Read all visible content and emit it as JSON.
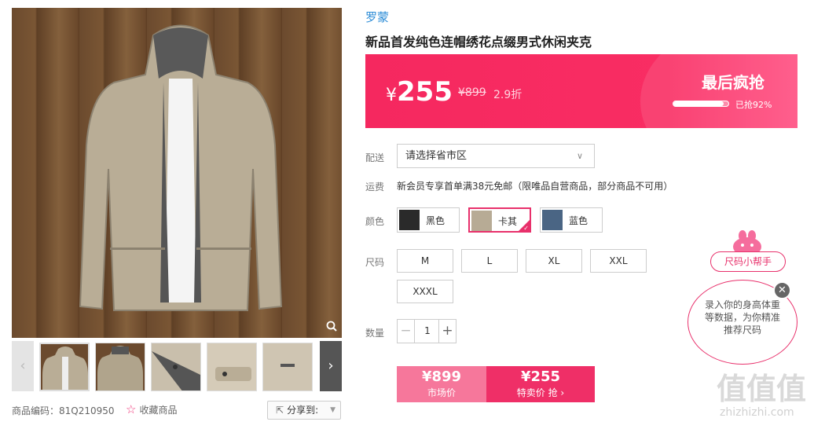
{
  "product": {
    "brand": "罗蒙",
    "title": "新品首发纯色连帽绣花点缀男式休闲夹克",
    "sku_label": "商品编码：81Q210950",
    "favorite_label": "收藏商品",
    "share_label": "分享到:"
  },
  "price": {
    "currency": "¥",
    "current": "255",
    "original": "¥899",
    "discount": "2.9折",
    "flash_title": "最后疯抢",
    "sold_percent": 92,
    "sold_text": "已抢92%"
  },
  "shipping": {
    "label": "配送",
    "region_placeholder": "请选择省市区",
    "fee_label": "运费",
    "fee_text": "新会员专享首单满38元免邮（限唯品自营商品，部分商品不可用）"
  },
  "colors": {
    "label": "颜色",
    "options": [
      {
        "name": "黑色",
        "swatch": "#2a2a2a",
        "selected": false
      },
      {
        "name": "卡其",
        "swatch": "#b7ab95",
        "selected": true
      },
      {
        "name": "蓝色",
        "swatch": "#4a6584",
        "selected": false
      }
    ]
  },
  "sizes": {
    "label": "尺码",
    "options": [
      "M",
      "L",
      "XL",
      "XXL",
      "XXXL"
    ]
  },
  "quantity": {
    "label": "数量",
    "value": "1",
    "minus": "−",
    "plus": "+"
  },
  "buy": {
    "market_price": "¥899",
    "market_label": "市场价",
    "special_price": "¥255",
    "special_label": "特卖价 抢 ›"
  },
  "size_helper": {
    "tag": "尺码小帮手",
    "text": "录入你的身高体重等数据，为你精准推荐尺码",
    "close": "✕"
  },
  "watermark": {
    "logo": "值值值",
    "url": "zhizhizhi.com"
  },
  "icons": {
    "zoom": "search-icon",
    "star": "star-icon",
    "share": "share-icon"
  },
  "colors_theme": {
    "accent": "#f5285f",
    "brand_blue": "#2a8bd6"
  }
}
